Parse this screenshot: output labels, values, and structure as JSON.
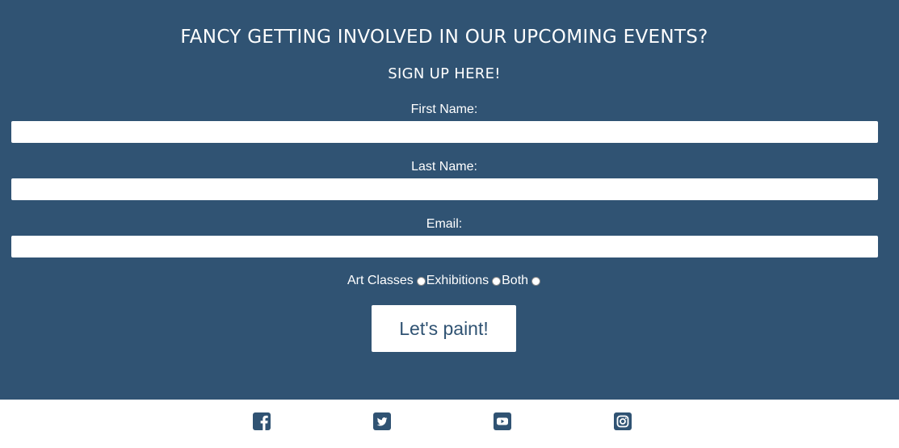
{
  "signup": {
    "heading": "FANCY GETTING INVOLVED IN OUR UPCOMING EVENTS?",
    "subheading": "SIGN UP HERE!",
    "fields": [
      {
        "label": "First Name:",
        "value": "",
        "placeholder": ""
      },
      {
        "label": "Last Name:",
        "value": "",
        "placeholder": ""
      },
      {
        "label": "Email:",
        "value": "",
        "placeholder": ""
      }
    ],
    "interest_options": [
      {
        "label": "Art Classes",
        "selected": false
      },
      {
        "label": "Exhibitions",
        "selected": false
      },
      {
        "label": "Both",
        "selected": false
      }
    ],
    "submit_label": "Let's paint!"
  },
  "footer": {
    "social_icons": [
      "facebook-icon",
      "twitter-icon",
      "youtube-icon",
      "instagram-icon"
    ]
  },
  "colors": {
    "background": "#305373",
    "text": "#ffffff",
    "footer_background": "#ffffff",
    "icon": "#305373"
  }
}
